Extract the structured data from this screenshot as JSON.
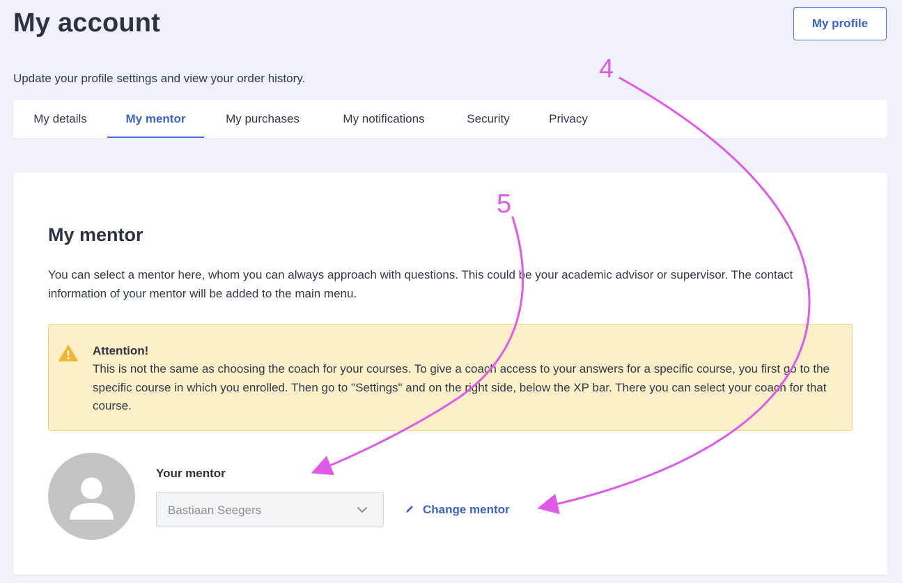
{
  "header": {
    "title": "My account",
    "profile_button": "My profile",
    "subtitle": "Update your profile settings and view your order history."
  },
  "tabs": [
    {
      "label": "My details",
      "active": false
    },
    {
      "label": "My mentor",
      "active": true
    },
    {
      "label": "My purchases",
      "active": false
    },
    {
      "label": "My notifications",
      "active": false
    },
    {
      "label": "Security",
      "active": false
    },
    {
      "label": "Privacy",
      "active": false
    }
  ],
  "mentor_card": {
    "title": "My mentor",
    "description": "You can select a mentor here, whom you can always approach with questions. This could be your academic advisor or supervisor. The contact information of your mentor will be added to the main menu.",
    "alert": {
      "icon": "warning-icon",
      "title": "Attention!",
      "text": "This is not the same as choosing the coach for your courses. To give a coach access to your answers for a specific course, you first go to the specific course in which you enrolled. Then go to \"Settings\" and on the right side, below the XP bar. There you can select your coach for that course."
    },
    "mentor_label": "Your mentor",
    "mentor_value": "Bastiaan Seegers",
    "change_link": "Change mentor"
  },
  "annotations": {
    "marker_4": "4",
    "marker_5": "5",
    "color": "#e05ae8"
  },
  "colors": {
    "accent": "#3d63c9",
    "background": "#f0f1fb",
    "alert_bg": "#fdf0c9"
  }
}
